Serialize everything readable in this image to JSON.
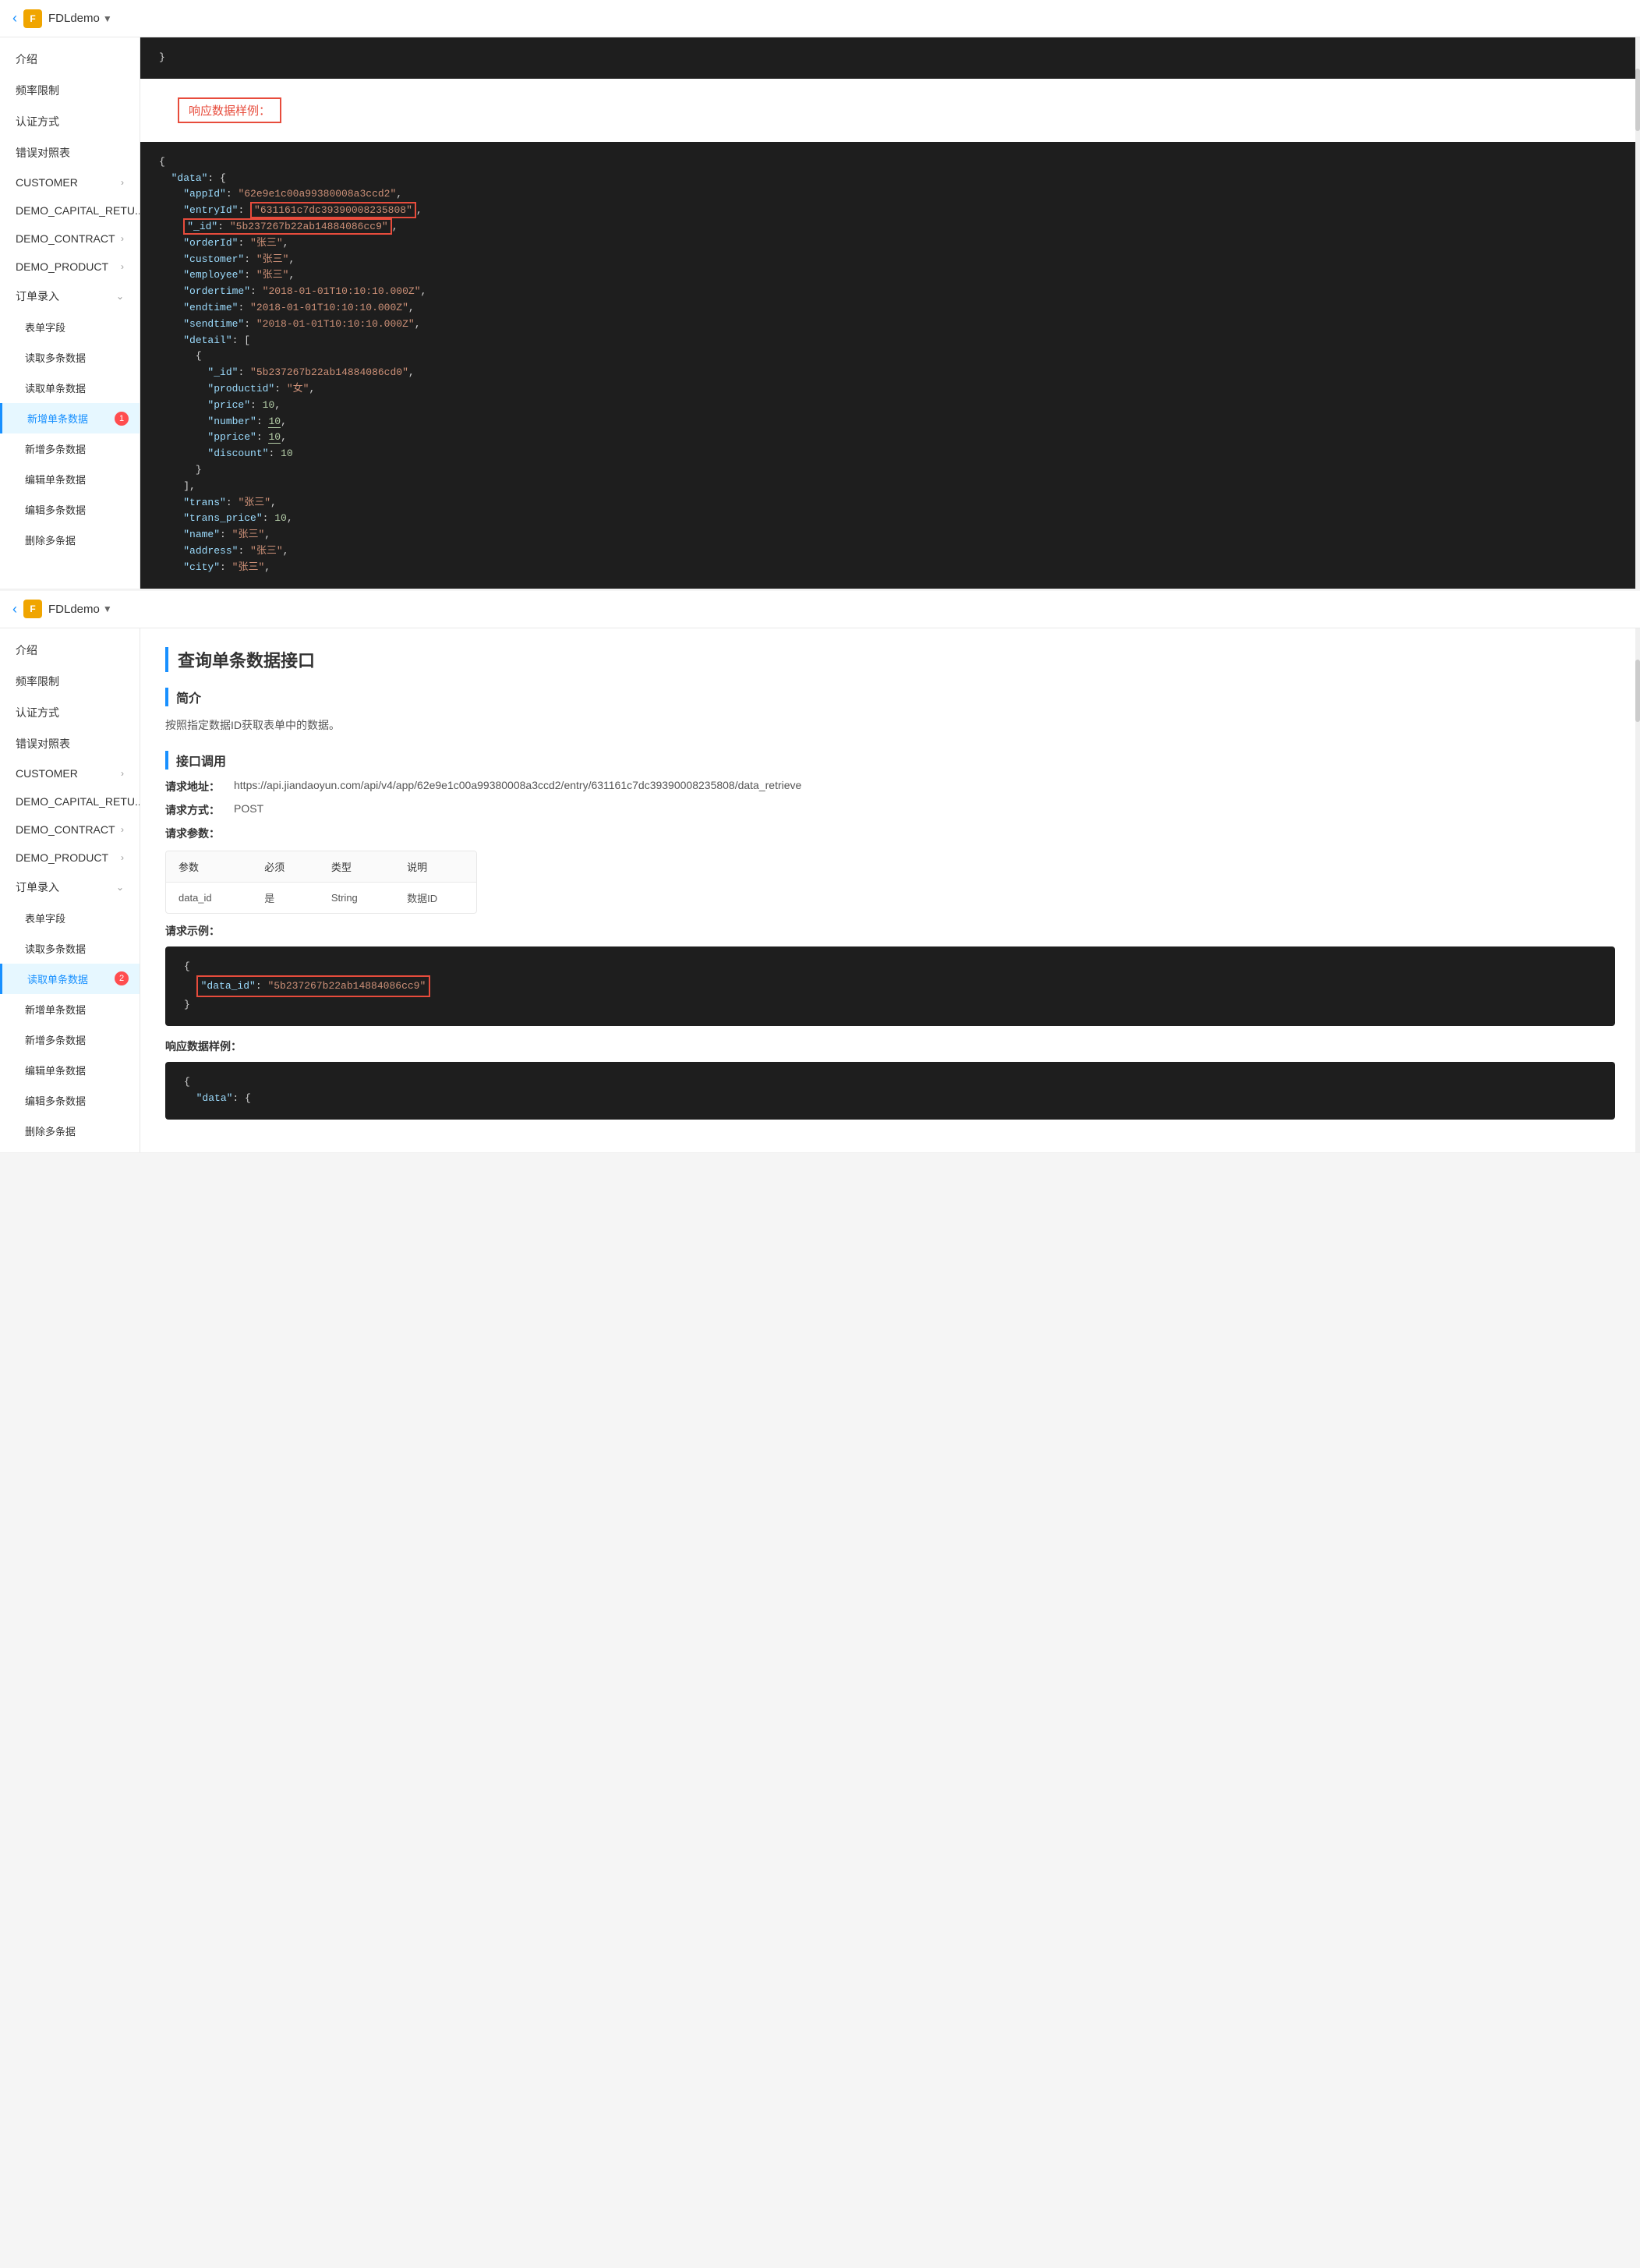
{
  "panels": [
    {
      "id": "panel1",
      "header": {
        "back_label": "‹",
        "app_icon": "F",
        "app_title": "FDLdemo",
        "dropdown_icon": "▼"
      },
      "sidebar": {
        "items": [
          {
            "label": "介绍",
            "type": "link",
            "active": false
          },
          {
            "label": "频率限制",
            "type": "link",
            "active": false
          },
          {
            "label": "认证方式",
            "type": "link",
            "active": false
          },
          {
            "label": "错误对照表",
            "type": "link",
            "active": false
          },
          {
            "label": "CUSTOMER",
            "type": "expand",
            "active": false
          },
          {
            "label": "DEMO_CAPITAL_RETU...",
            "type": "expand",
            "active": false
          },
          {
            "label": "DEMO_CONTRACT",
            "type": "expand",
            "active": false
          },
          {
            "label": "DEMO_PRODUCT",
            "type": "expand",
            "active": false
          },
          {
            "label": "订单录入",
            "type": "expand-open",
            "active": false
          },
          {
            "label": "表单字段",
            "type": "sub",
            "active": false
          },
          {
            "label": "读取多条数据",
            "type": "sub",
            "active": false
          },
          {
            "label": "读取单条数据",
            "type": "sub",
            "active": false
          },
          {
            "label": "新增单条数据",
            "type": "sub",
            "active": true,
            "badge": "1"
          },
          {
            "label": "新增多条数据",
            "type": "sub",
            "active": false
          },
          {
            "label": "编辑单条数据",
            "type": "sub",
            "active": false
          },
          {
            "label": "编辑多条数据",
            "type": "sub",
            "active": false
          },
          {
            "label": "删除多条据",
            "type": "sub",
            "active": false
          }
        ]
      },
      "content": {
        "type": "code_with_response",
        "closing_brace": "}",
        "response_label": "响应数据样例：",
        "code_json": {
          "data": {
            "appId": "62e9e1c00a99380008a3ccd2",
            "entryId": "631161c7dc39390008235808",
            "_id": "5b237267b22ab14884086cc9",
            "orderId": "张三",
            "customer": "张三",
            "employee": "张三",
            "ordertime": "2018-01-01T10:10:10.000Z",
            "endtime": "2018-01-01T10:10:10.000Z",
            "sendtime": "2018-01-01T10:10:10.000Z",
            "detail_id": "5b237267b22ab14884086cd0",
            "productid": "女",
            "price": 10,
            "number": 10,
            "pprice": 10,
            "discount": 10,
            "trans": "张三",
            "trans_price": 10,
            "name": "张三",
            "address": "张三",
            "city": "张三"
          }
        }
      }
    },
    {
      "id": "panel2",
      "header": {
        "back_label": "‹",
        "app_icon": "F",
        "app_title": "FDLdemo",
        "dropdown_icon": "▼"
      },
      "sidebar": {
        "items": [
          {
            "label": "介绍",
            "type": "link",
            "active": false
          },
          {
            "label": "频率限制",
            "type": "link",
            "active": false
          },
          {
            "label": "认证方式",
            "type": "link",
            "active": false
          },
          {
            "label": "错误对照表",
            "type": "link",
            "active": false
          },
          {
            "label": "CUSTOMER",
            "type": "expand",
            "active": false
          },
          {
            "label": "DEMO_CAPITAL_RETU...",
            "type": "expand",
            "active": false
          },
          {
            "label": "DEMO_CONTRACT",
            "type": "expand",
            "active": false
          },
          {
            "label": "DEMO_PRODUCT",
            "type": "expand",
            "active": false
          },
          {
            "label": "订单录入",
            "type": "expand-open",
            "active": false
          },
          {
            "label": "表单字段",
            "type": "sub",
            "active": false
          },
          {
            "label": "读取多条数据",
            "type": "sub",
            "active": false
          },
          {
            "label": "读取单条数据",
            "type": "sub",
            "active": true,
            "badge": "2"
          },
          {
            "label": "新增单条数据",
            "type": "sub",
            "active": false
          },
          {
            "label": "新增多条数据",
            "type": "sub",
            "active": false
          },
          {
            "label": "编辑单条数据",
            "type": "sub",
            "active": false
          },
          {
            "label": "编辑多条数据",
            "type": "sub",
            "active": false
          },
          {
            "label": "删除多条据",
            "type": "sub",
            "active": false
          }
        ]
      },
      "content": {
        "type": "doc",
        "title": "查询单条数据接口",
        "intro_title": "简介",
        "intro_text": "按照指定数据ID获取表单中的数据。",
        "api_title": "接口调用",
        "request_url_label": "请求地址：",
        "request_url": "https://api.jiandaoyun.com/api/v4/app/62e9e1c00a99380008a3ccd2/entry/631161c7dc39390008235808/data_retrieve",
        "request_method_label": "请求方式：",
        "request_method": "POST",
        "request_params_label": "请求参数：",
        "table_headers": [
          "参数",
          "必须",
          "类型",
          "说明"
        ],
        "table_rows": [
          [
            "data_id",
            "是",
            "String",
            "数据ID"
          ]
        ],
        "request_example_label": "请求示例：",
        "response_label": "响应数据样例：",
        "example_data_id": "5b237267b22ab14884086cc9",
        "response_code_start": "{\n  \"data\": {"
      }
    }
  ],
  "colors": {
    "accent": "#1890ff",
    "danger": "#e74c3c",
    "active_bg": "#e6f7ff",
    "code_bg": "#1e1e1e"
  }
}
